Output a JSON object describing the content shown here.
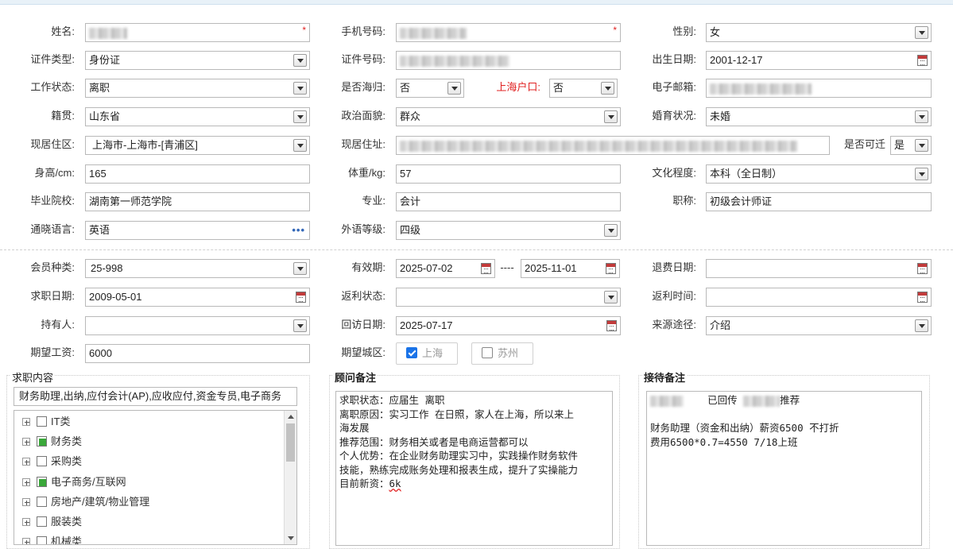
{
  "form": {
    "name": {
      "label": "姓名:",
      "required": "*"
    },
    "phone": {
      "label": "手机号码:",
      "required": "*"
    },
    "gender": {
      "label": "性别:",
      "value": "女"
    },
    "id_type": {
      "label": "证件类型:",
      "value": "身份证"
    },
    "id_number": {
      "label": "证件号码:"
    },
    "birth_date": {
      "label": "出生日期:",
      "value": "2001-12-17"
    },
    "work_status": {
      "label": "工作状态:",
      "value": "离职"
    },
    "overseas": {
      "label": "是否海归:",
      "value": "否"
    },
    "shanghai_hukou": {
      "label": "上海户口:",
      "value": "否"
    },
    "email": {
      "label": "电子邮箱:"
    },
    "native_place": {
      "label": "籍贯:",
      "value": "山东省"
    },
    "political": {
      "label": "政治面貌:",
      "value": "群众"
    },
    "marital": {
      "label": "婚育状况:",
      "value": "未婚"
    },
    "current_area": {
      "label": "现居住区:",
      "value": "上海市-上海市-[青浦区]"
    },
    "current_address": {
      "label": "现居住址:"
    },
    "relocate": {
      "label": "是否可迁",
      "value": "是"
    },
    "height": {
      "label": "身高/cm:",
      "value": "165"
    },
    "weight": {
      "label": "体重/kg:",
      "value": "57"
    },
    "education": {
      "label": "文化程度:",
      "value": "本科（全日制）"
    },
    "school": {
      "label": "毕业院校:",
      "value": "湖南第一师范学院"
    },
    "major": {
      "label": "专业:",
      "value": "会计"
    },
    "title": {
      "label": "职称:",
      "value": "初级会计师证"
    },
    "language": {
      "label": "通晓语言:",
      "value": "英语"
    },
    "foreign_level": {
      "label": "外语等级:",
      "value": "四级"
    }
  },
  "member": {
    "type": {
      "label": "会员种类:",
      "value": "25-998"
    },
    "valid": {
      "label": "有效期:",
      "start": "2025-07-02",
      "dash": "----",
      "end": "2025-11-01"
    },
    "refund_date": {
      "label": "退费日期:",
      "value": ""
    },
    "job_date": {
      "label": "求职日期:",
      "value": "2009-05-01"
    },
    "rebate_status": {
      "label": "返利状态:",
      "value": ""
    },
    "rebate_time": {
      "label": "返利时间:",
      "value": ""
    },
    "holder": {
      "label": "持有人:",
      "value": ""
    },
    "visit_date": {
      "label": "回访日期:",
      "value": "2025-07-17"
    },
    "source": {
      "label": "来源途径:",
      "value": "介绍"
    },
    "salary": {
      "label": "期望工资:",
      "value": "6000"
    },
    "city": {
      "label": "期望城区:",
      "options": [
        {
          "label": "上海",
          "checked": true
        },
        {
          "label": "苏州",
          "checked": false
        }
      ]
    }
  },
  "job_content": {
    "title": "求职内容",
    "selected": "财务助理,出纳,应付会计(AP),应收应付,资金专员,电子商务",
    "tree": [
      {
        "label": "IT类",
        "state": "none"
      },
      {
        "label": "财务类",
        "state": "partial"
      },
      {
        "label": "采购类",
        "state": "none"
      },
      {
        "label": "电子商务/互联网",
        "state": "partial"
      },
      {
        "label": "房地产/建筑/物业管理",
        "state": "none"
      },
      {
        "label": "服装类",
        "state": "none"
      },
      {
        "label": "机械类",
        "state": "none"
      }
    ]
  },
  "advisor_notes": {
    "title": "顾问备注",
    "lines": [
      "求职状态：应届生 离职",
      "离职原因：实习工作 在日照，家人在上海，所以来上",
      "海发展",
      "推荐范围：财务相关或者是电商运营都可以",
      "个人优势：在企业财务助理实习中，实践操作财务软件",
      "技能，熟练完成账务处理和报表生成，提升了实操能力",
      "目前新资："
    ],
    "salary_tail": "6k"
  },
  "reception_notes": {
    "title": "接待备注",
    "line1_a": "已回传",
    "line1_b": "推荐",
    "line2": "财务助理（资金和出纳）薪资6500 不打折",
    "line3": "费用6500*0.7=4550 7/18上班"
  }
}
